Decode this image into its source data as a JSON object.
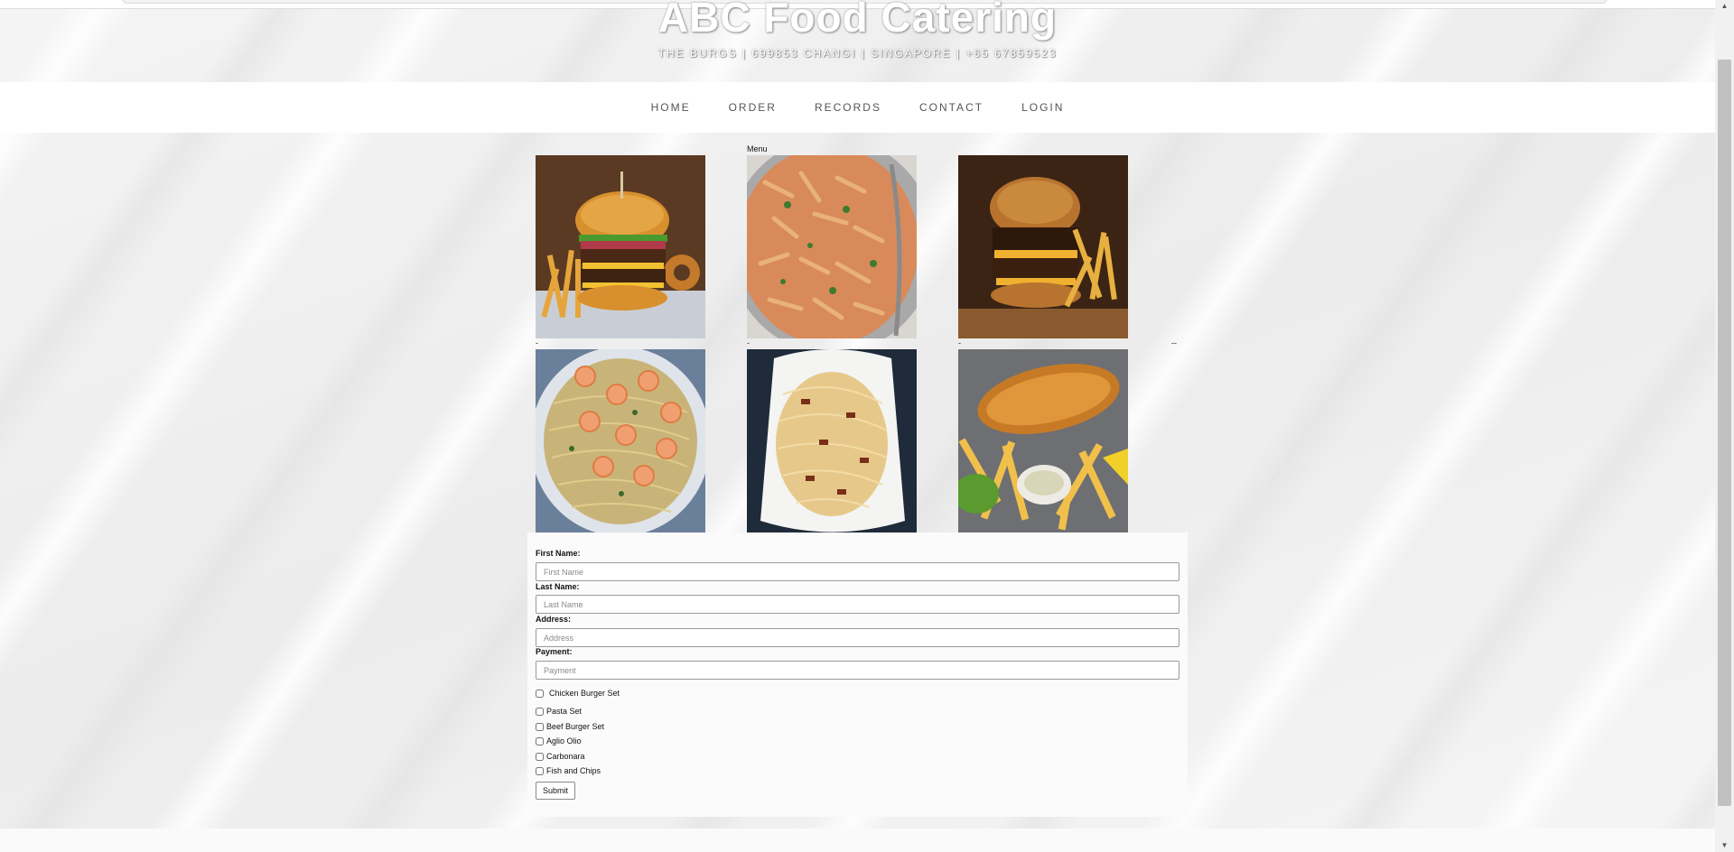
{
  "header": {
    "title": "ABC Food Catering",
    "subtitle": "THE BURGS | 699853 CHANGI | SINGAPORE | +65 67859523"
  },
  "nav": {
    "items": [
      {
        "label": "HOME"
      },
      {
        "label": "ORDER"
      },
      {
        "label": "RECORDS"
      },
      {
        "label": "CONTACT"
      },
      {
        "label": "LOGIN"
      }
    ]
  },
  "menu": {
    "label": "Menu",
    "dash_single": "-",
    "dash_double": "--",
    "images": [
      {
        "icon": "chicken-burger-image"
      },
      {
        "icon": "pasta-image"
      },
      {
        "icon": "beef-burger-image"
      },
      {
        "icon": "aglio-olio-image"
      },
      {
        "icon": "carbonara-image"
      },
      {
        "icon": "fish-and-chips-image"
      }
    ]
  },
  "form": {
    "first_name": {
      "label": "First Name:",
      "placeholder": "First Name",
      "value": ""
    },
    "last_name": {
      "label": "Last Name:",
      "placeholder": "Last Name",
      "value": ""
    },
    "address": {
      "label": "Address:",
      "placeholder": "Address",
      "value": ""
    },
    "payment": {
      "label": "Payment:",
      "placeholder": "Payment",
      "value": ""
    },
    "options": [
      {
        "label": "Chicken Burger Set",
        "checked": false
      },
      {
        "label": "Pasta Set",
        "checked": false
      },
      {
        "label": "Beef Burger Set",
        "checked": false
      },
      {
        "label": "Aglio Olio",
        "checked": false
      },
      {
        "label": "Carbonara",
        "checked": false
      },
      {
        "label": "Fish and Chips",
        "checked": false
      }
    ],
    "submit_label": "Submit"
  }
}
